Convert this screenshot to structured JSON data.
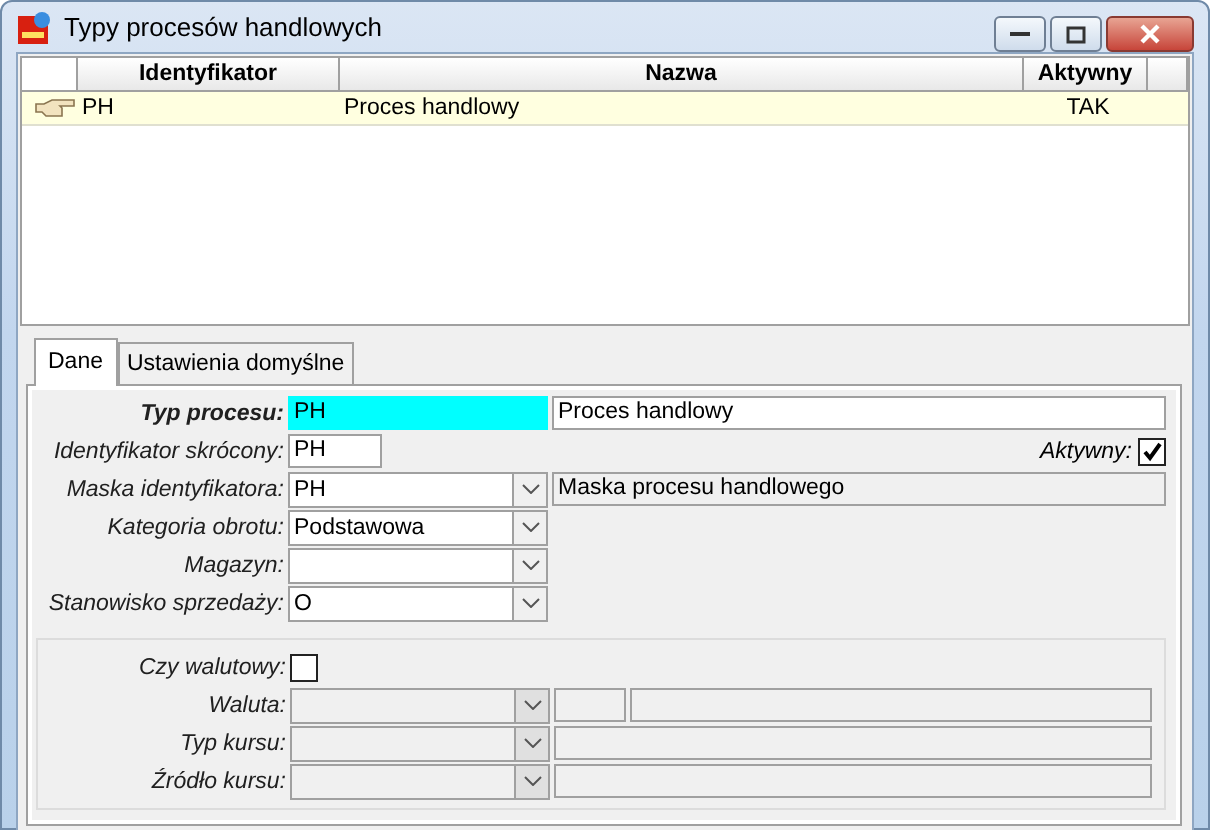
{
  "window": {
    "title": "Typy procesów handlowych"
  },
  "table": {
    "columns": [
      "Identyfikator",
      "Nazwa",
      "Aktywny"
    ],
    "rows": [
      {
        "cells": [
          "PH",
          "Proces handlowy",
          "TAK"
        ],
        "selected": true
      }
    ]
  },
  "tabs": [
    {
      "label": "Dane",
      "selected": true
    },
    {
      "label": "Ustawienia domyślne",
      "selected": false
    }
  ],
  "form": {
    "fields": [
      {
        "label": "Typ procesu:",
        "required": true,
        "kind": "text",
        "value": "PH",
        "focused": true,
        "extras": [
          {
            "kind": "name",
            "value": "Proces handlowy",
            "disabled": false
          }
        ]
      },
      {
        "label": "Identyfikator skrócony:",
        "required": false,
        "kind": "short_text",
        "value": "PH",
        "focused": false,
        "side_check": {
          "label": "Aktywny:",
          "checked": true
        }
      },
      {
        "label": "Maska identyfikatora:",
        "required": false,
        "kind": "combo",
        "value": "PH",
        "focused": false,
        "extras": [
          {
            "kind": "name",
            "value": "Maska procesu handlowego",
            "disabled": true
          }
        ]
      },
      {
        "label": "Kategoria obrotu:",
        "required": false,
        "kind": "combo",
        "value": "Podstawowa",
        "focused": false
      },
      {
        "label": "Magazyn:",
        "required": false,
        "kind": "combo",
        "focused": false
      },
      {
        "label": "Stanowisko sprzedaży:",
        "required": false,
        "kind": "combo",
        "value": "O",
        "focused": false
      }
    ],
    "currency_group": [
      {
        "label": "Czy walutowy:",
        "kind": "checkbox",
        "checked": false
      },
      {
        "label": "Waluta:",
        "kind": "combo",
        "disabled": true,
        "extras": [
          {
            "kind": "code",
            "disabled": true
          },
          {
            "kind": "name",
            "disabled": true
          }
        ]
      },
      {
        "label": "Typ kursu:",
        "kind": "combo",
        "disabled": true,
        "extras": [
          {
            "kind": "name",
            "disabled": true
          }
        ]
      },
      {
        "label": "Źródło kursu:",
        "kind": "combo",
        "disabled": true,
        "extras": [
          {
            "kind": "name",
            "disabled": true
          }
        ]
      }
    ]
  }
}
